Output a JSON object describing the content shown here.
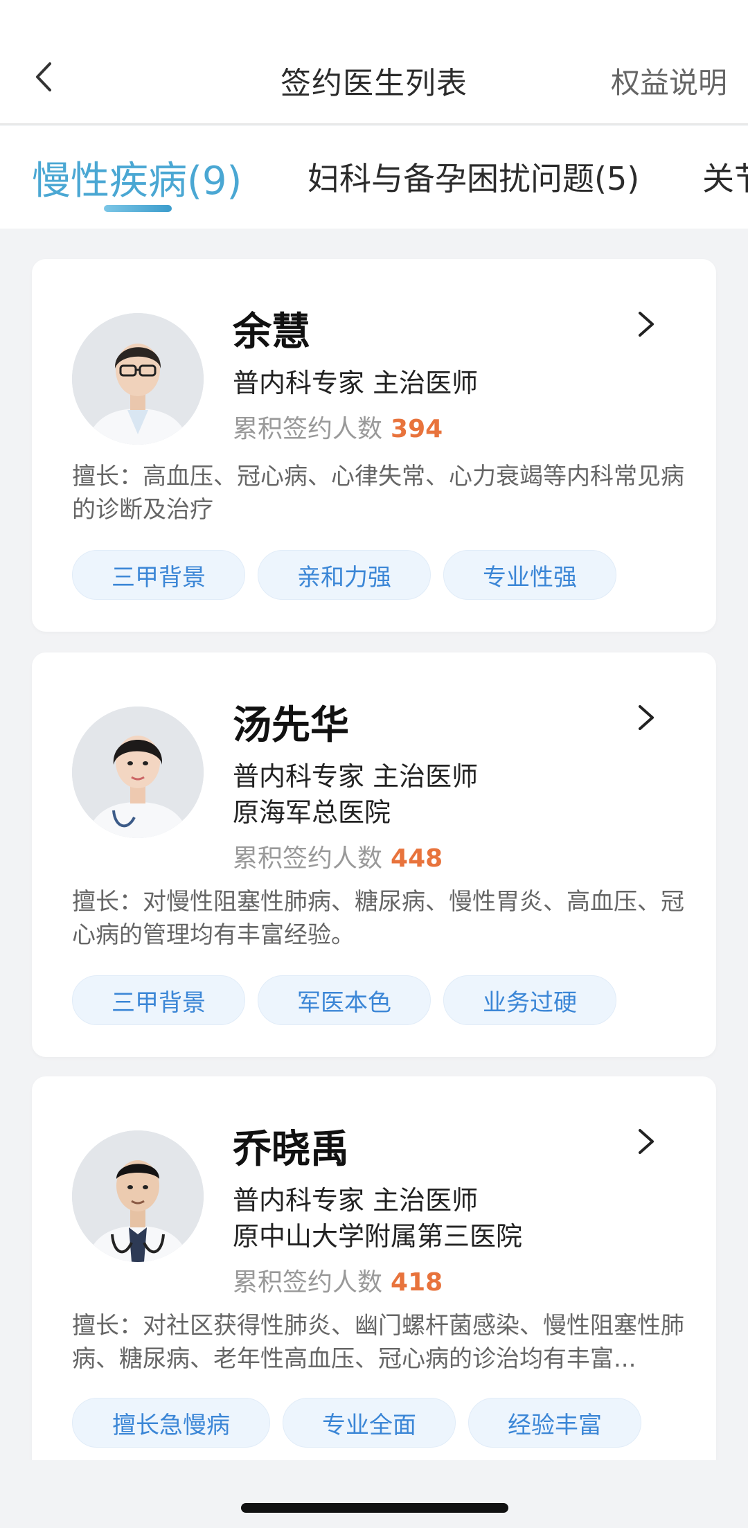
{
  "header": {
    "title": "签约医生列表",
    "rights_label": "权益说明"
  },
  "tabs": [
    {
      "label": "慢性疾病(9)",
      "active": true
    },
    {
      "label": "妇科与备孕困扰问题(5)",
      "active": false
    },
    {
      "label": "关节",
      "active": false
    }
  ],
  "doctors": [
    {
      "name": "余慧",
      "title": "普内科专家  主治医师",
      "signed_label": "累积签约人数",
      "signed_count": "394",
      "specialty": "擅长：高血压、冠心病、心律失常、心力衰竭等内科常见病的诊断及治疗",
      "tags": [
        "三甲背景",
        "亲和力强",
        "专业性强"
      ]
    },
    {
      "name": "汤先华",
      "title": "普内科专家  主治医师",
      "hospital": "原海军总医院",
      "signed_label": "累积签约人数",
      "signed_count": "448",
      "specialty": "擅长：对慢性阻塞性肺病、糖尿病、慢性胃炎、高血压、冠心病的管理均有丰富经验。",
      "tags": [
        "三甲背景",
        "军医本色",
        "业务过硬"
      ]
    },
    {
      "name": "乔晓禹",
      "title": "普内科专家  主治医师",
      "hospital": "原中山大学附属第三医院",
      "signed_label": "累积签约人数",
      "signed_count": "418",
      "specialty": "擅长：对社区获得性肺炎、幽门螺杆菌感染、慢性阻塞性肺病、糖尿病、老年性高血压、冠心病的诊治均有丰富...",
      "tags": [
        "擅长急慢病",
        "专业全面",
        "经验丰富"
      ]
    }
  ],
  "colors": {
    "accent": "#4aa7d3",
    "count": "#e8733c",
    "tag_text": "#3b86d6",
    "tag_bg": "#edf5fd"
  }
}
